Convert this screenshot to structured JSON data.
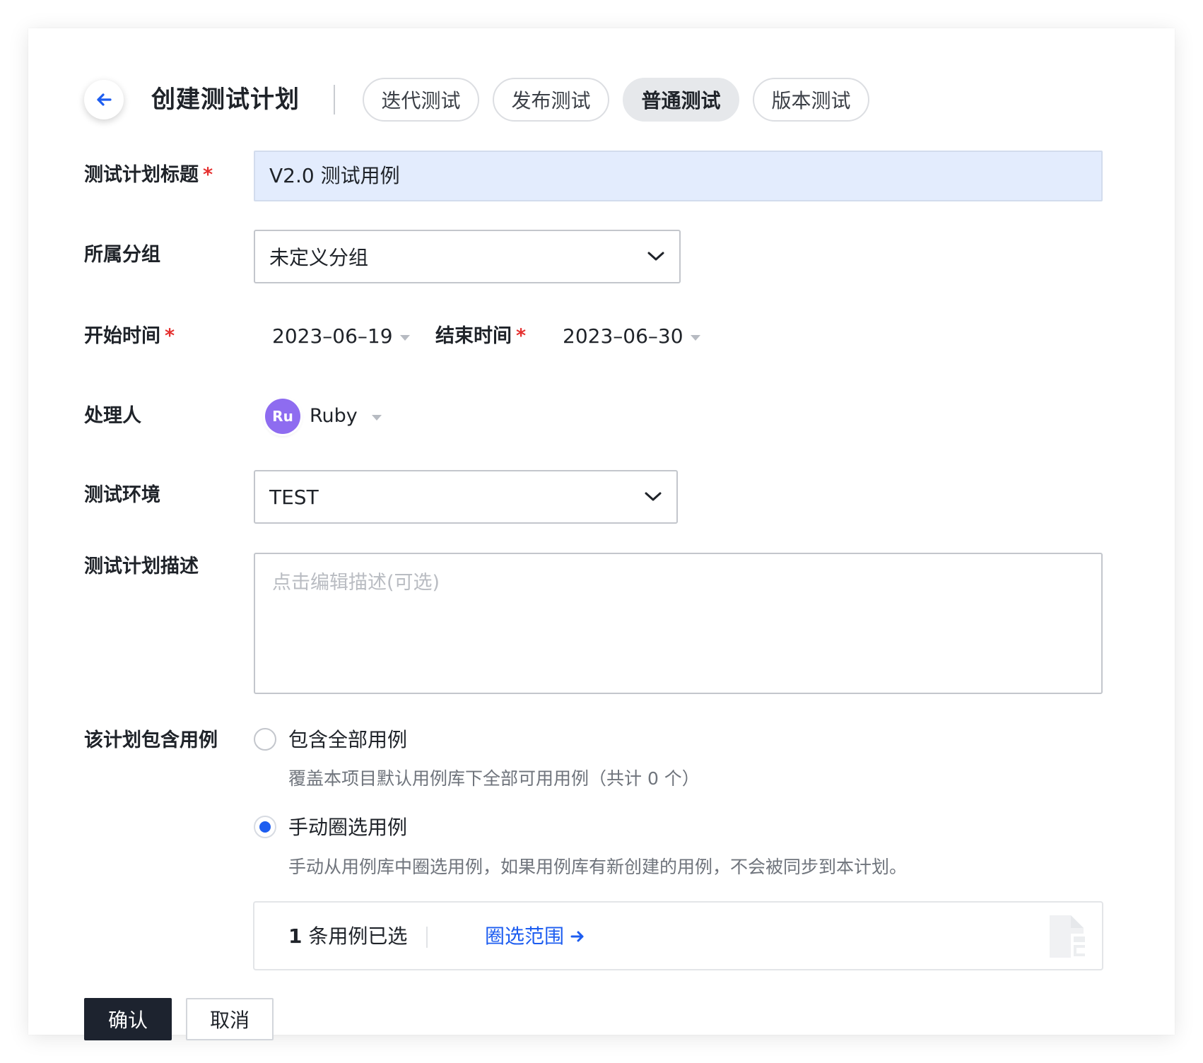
{
  "header": {
    "title": "创建测试计划",
    "tabs": [
      {
        "label": "迭代测试",
        "active": false
      },
      {
        "label": "发布测试",
        "active": false
      },
      {
        "label": "普通测试",
        "active": true
      },
      {
        "label": "版本测试",
        "active": false
      }
    ]
  },
  "form": {
    "plan_title": {
      "label": "测试计划标题",
      "required_mark": "*",
      "value": "V2.0 测试用例"
    },
    "group": {
      "label": "所属分组",
      "value": "未定义分组"
    },
    "start_time": {
      "label": "开始时间",
      "required_mark": "*",
      "value": "2023–06–19"
    },
    "end_time": {
      "label": "结束时间",
      "required_mark": "*",
      "value": "2023–06–30"
    },
    "assignee": {
      "label": "处理人",
      "avatar_initials": "Ru",
      "avatar_color": "#8e6cf0",
      "name": "Ruby"
    },
    "environment": {
      "label": "测试环境",
      "value": "TEST"
    },
    "description": {
      "label": "测试计划描述",
      "placeholder": "点击编辑描述(可选)",
      "value": ""
    },
    "cases": {
      "label": "该计划包含用例",
      "options": [
        {
          "label": "包含全部用例",
          "hint": "覆盖本项目默认用例库下全部可用用例（共计 0 个）",
          "checked": false
        },
        {
          "label": "手动圈选用例",
          "hint": "手动从用例库中圈选用例，如果用例库有新创建的用例，不会被同步到本计划。",
          "checked": true
        }
      ],
      "selected_count": "1",
      "selected_suffix": "条用例已选",
      "scope_link": "圈选范围"
    }
  },
  "actions": {
    "confirm": "确认",
    "cancel": "取消"
  },
  "colors": {
    "primary": "#1d5df0",
    "required": "#e5302f",
    "confirm_bg": "#1d232f",
    "title_input_bg": "#e3ecfd"
  },
  "icons": {
    "back": "arrow-left-icon",
    "select": "chevron-down-icon",
    "dropdown": "caret-down-icon",
    "link": "arrow-right-icon",
    "panel": "document-icon"
  }
}
